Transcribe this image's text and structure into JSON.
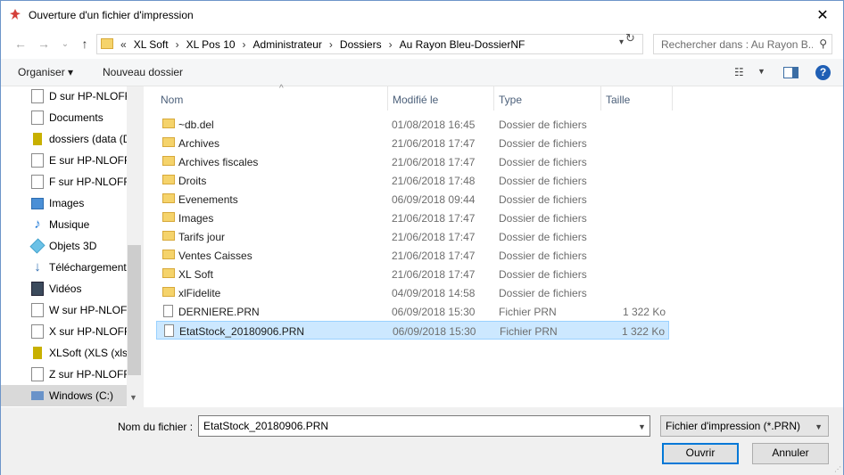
{
  "window": {
    "title": "Ouverture d'un fichier d'impression",
    "close_glyph": "✕"
  },
  "nav": {
    "back_glyph": "←",
    "forward_glyph": "→",
    "recent_glyph": "⌄",
    "up_glyph": "↑",
    "overflow": "«",
    "breadcrumbs": [
      "XL Soft",
      "XL Pos 10",
      "Administrateur",
      "Dossiers",
      "Au Rayon Bleu-DossierNF"
    ],
    "separator": "›",
    "search_placeholder": "Rechercher dans : Au Rayon B..."
  },
  "toolbar": {
    "organize_label": "Organiser",
    "organize_chev": "▾",
    "new_folder_label": "Nouveau dossier",
    "help_glyph": "?"
  },
  "sidebar": {
    "items": [
      {
        "label": "D sur HP-NLOFFI",
        "icon": "drive-icon"
      },
      {
        "label": "Documents",
        "icon": "documents-icon"
      },
      {
        "label": "dossiers (data (D",
        "icon": "network-drive-icon"
      },
      {
        "label": "E sur HP-NLOFFI",
        "icon": "drive-icon"
      },
      {
        "label": "F sur HP-NLOFFI",
        "icon": "drive-icon"
      },
      {
        "label": "Images",
        "icon": "images-icon"
      },
      {
        "label": "Musique",
        "icon": "music-icon"
      },
      {
        "label": "Objets 3D",
        "icon": "objects-3d-icon"
      },
      {
        "label": "Téléchargements",
        "icon": "downloads-icon"
      },
      {
        "label": "Vidéos",
        "icon": "videos-icon"
      },
      {
        "label": "W sur HP-NLOFFI",
        "icon": "drive-icon"
      },
      {
        "label": "X sur HP-NLOFFI",
        "icon": "drive-icon"
      },
      {
        "label": "XLSoft (XLS (xls))",
        "icon": "network-drive-icon"
      },
      {
        "label": "Z sur HP-NLOFFI",
        "icon": "drive-icon"
      },
      {
        "label": "Windows (C:)",
        "icon": "windows-drive-icon",
        "selected": true
      }
    ]
  },
  "filelist": {
    "columns": {
      "name": "Nom",
      "modified": "Modifié le",
      "type": "Type",
      "size": "Taille"
    },
    "rows": [
      {
        "name": "~db.del",
        "modified": "01/08/2018 16:45",
        "type": "Dossier de fichiers",
        "size": "",
        "kind": "folder"
      },
      {
        "name": "Archives",
        "modified": "21/06/2018 17:47",
        "type": "Dossier de fichiers",
        "size": "",
        "kind": "folder"
      },
      {
        "name": "Archives fiscales",
        "modified": "21/06/2018 17:47",
        "type": "Dossier de fichiers",
        "size": "",
        "kind": "folder"
      },
      {
        "name": "Droits",
        "modified": "21/06/2018 17:48",
        "type": "Dossier de fichiers",
        "size": "",
        "kind": "folder"
      },
      {
        "name": "Evenements",
        "modified": "06/09/2018 09:44",
        "type": "Dossier de fichiers",
        "size": "",
        "kind": "folder"
      },
      {
        "name": "Images",
        "modified": "21/06/2018 17:47",
        "type": "Dossier de fichiers",
        "size": "",
        "kind": "folder"
      },
      {
        "name": "Tarifs jour",
        "modified": "21/06/2018 17:47",
        "type": "Dossier de fichiers",
        "size": "",
        "kind": "folder"
      },
      {
        "name": "Ventes Caisses",
        "modified": "21/06/2018 17:47",
        "type": "Dossier de fichiers",
        "size": "",
        "kind": "folder"
      },
      {
        "name": "XL Soft",
        "modified": "21/06/2018 17:47",
        "type": "Dossier de fichiers",
        "size": "",
        "kind": "folder"
      },
      {
        "name": "xlFidelite",
        "modified": "04/09/2018 14:58",
        "type": "Dossier de fichiers",
        "size": "",
        "kind": "folder"
      },
      {
        "name": "DERNIERE.PRN",
        "modified": "06/09/2018 15:30",
        "type": "Fichier PRN",
        "size": "1 322 Ko",
        "kind": "file"
      },
      {
        "name": "EtatStock_20180906.PRN",
        "modified": "06/09/2018 15:30",
        "type": "Fichier PRN",
        "size": "1 322 Ko",
        "kind": "file",
        "selected": true
      }
    ]
  },
  "bottom": {
    "filename_label": "Nom du fichier :",
    "filename_value": "EtatStock_20180906.PRN",
    "filetype_value": "Fichier d'impression (*.PRN)",
    "open_label": "Ouvrir",
    "cancel_label": "Annuler"
  }
}
